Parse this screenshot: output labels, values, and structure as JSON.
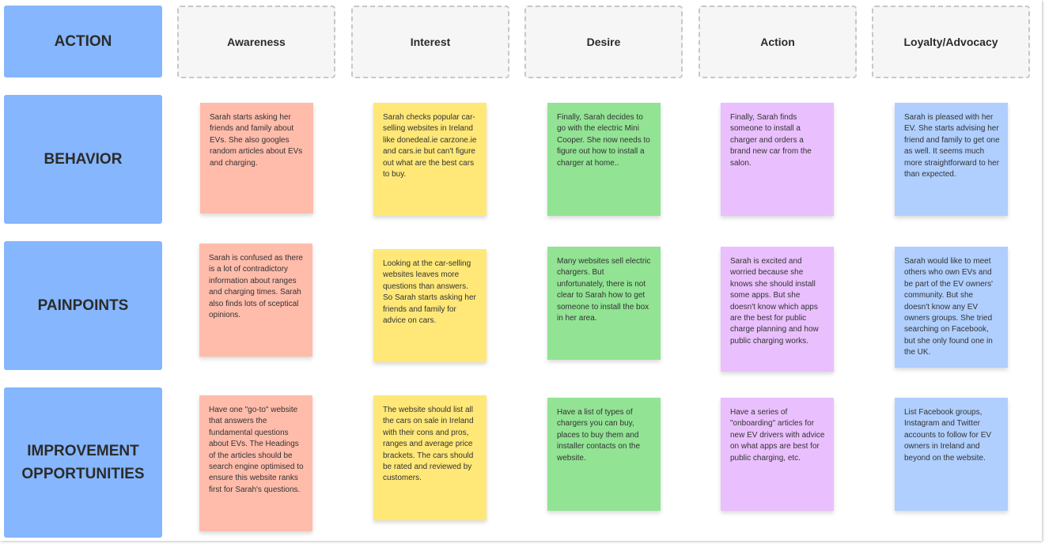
{
  "colors": {
    "row_header": "#86b6fd",
    "awareness": "#ffbcab",
    "interest": "#ffe878",
    "desire": "#92e394",
    "action": "#e9c0fd",
    "loyalty": "#b0cffe",
    "stage_header": "#f6f6f6"
  },
  "row_headers": [
    "ACTION",
    "BEHAVIOR",
    "PAINPOINTS",
    "IMPROVEMENT OPPORTUNITIES"
  ],
  "stages": [
    "Awareness",
    "Interest",
    "Desire",
    "Action",
    "Loyalty/Advocacy"
  ],
  "behavior": [
    "Sarah starts asking her friends and family about EVs. She also googles random articles about EVs and charging.",
    "Sarah checks popular car-selling websites in Ireland like donedeal.ie carzone.ie and cars.ie but can't figure out what are the best cars to buy.",
    "Finally, Sarah decides to go with the electric Mini Cooper. She now needs to figure out how to install a charger at home..",
    "Finally, Sarah finds someone to install a charger and orders a brand new car from the salon.",
    "Sarah is pleased with her EV. She starts advising her friend and family to get one as well. It seems much more straightforward to her than expected."
  ],
  "painpoints": [
    "Sarah is confused as there is a lot of contradictory information about ranges and charging times. Sarah also finds lots of sceptical opinions.",
    "Looking at the car-selling websites leaves more questions than answers. So Sarah starts asking her friends and family for advice on cars.",
    "Many websites sell electric chargers. But unfortunately, there is not clear to Sarah how to get someone to install the box in her area.",
    "Sarah is excited and worried because she knows she should install some apps. But she doesn't know which apps are the best for public charge planning and how public charging works.",
    "Sarah would like to meet others who own EVs and be part of the EV owners' community. But she doesn't know any EV owners groups. She tried searching on Facebook, but she only found one in the UK."
  ],
  "improvements": [
    "Have one \"go-to\" website that answers the fundamental questions about EVs. The Headings of the articles should be search engine optimised to ensure this website ranks first for Sarah's questions.",
    "The website should list all the cars on sale in Ireland with their cons and pros, ranges and average price brackets.  The cars should be rated and reviewed by customers.",
    "Have a list of types of chargers you can buy, places to buy them and installer contacts on the website.",
    "Have a series of \"onboarding\" articles for new EV drivers with advice on what apps are best for public charging, etc.",
    "List Facebook groups, Instagram and Twitter accounts to follow for EV owners in Ireland and beyond on the website."
  ]
}
